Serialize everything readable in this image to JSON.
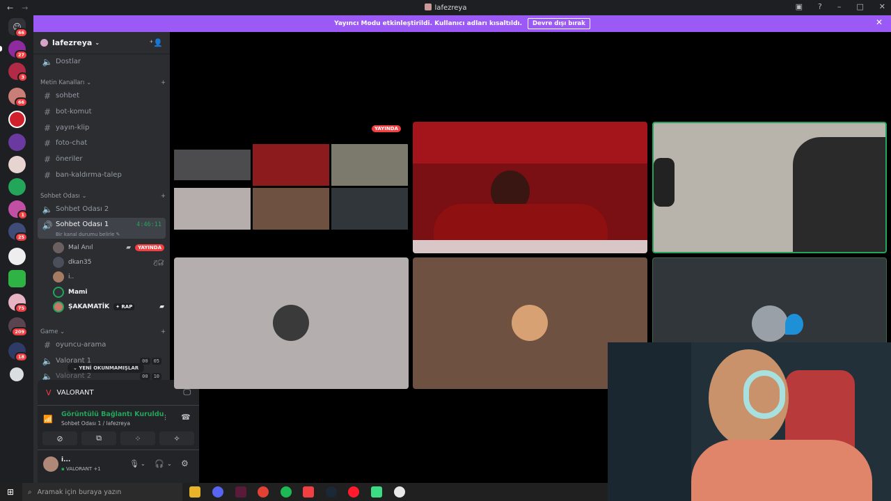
{
  "window": {
    "title": "lafezreya",
    "back": "←",
    "forward": "→"
  },
  "banner": {
    "text": "Yayıncı Modu etkinleştirildi. Kullanıcı adları kısaltıldı.",
    "button": "Devre dışı bırak"
  },
  "rail_badges": [
    "66",
    "27",
    "3",
    "66",
    "1",
    "25",
    "75",
    "209",
    "18"
  ],
  "server": {
    "name": "lafezreya"
  },
  "sidebar": {
    "friends": "Dostlar",
    "text_category": "Metin Kanalları",
    "text_channels": [
      "sohbet",
      "bot-komut",
      "yayın-klip",
      "foto-chat",
      "öneriler",
      "ban-kaldırma-talep"
    ],
    "voice_category": "Sohbet Odası",
    "voice_channels": [
      "Sohbet Odası 2",
      "Sohbet Odası 1"
    ],
    "timer": "4:46:11",
    "status_placeholder": "Bir kanal durumu belirle",
    "users": [
      {
        "name": "Mal Anıl",
        "live": "YAYINDA"
      },
      {
        "name": "dkan35"
      },
      {
        "name": "i.."
      },
      {
        "name": "Mami"
      },
      {
        "name": "ŞAKAMATİK",
        "tag": "RAP"
      }
    ],
    "game_category": "Game",
    "game_channels": [
      "oyuncu-arama",
      "Valorant 1",
      "Valorant 2"
    ],
    "counts": [
      [
        "00",
        "05"
      ],
      [
        "00",
        "10"
      ]
    ],
    "new_unread": "YENİ OKUNMAMIŞLAR"
  },
  "panel": {
    "activity": "VALORANT",
    "voice_status": "Görüntülü Bağlantı Kuruldu",
    "voice_location": "Sohbet Odası 1 / lafezreya",
    "user_name": "i...",
    "user_status": "VALORANT +1"
  },
  "stage": {
    "live_badge": "YAYINDA"
  },
  "taskbar": {
    "search_placeholder": "Aramak için buraya yazın"
  },
  "colors": {
    "accent": "#9b59f6",
    "live": "#f23f42",
    "voice_green": "#23a55a"
  }
}
